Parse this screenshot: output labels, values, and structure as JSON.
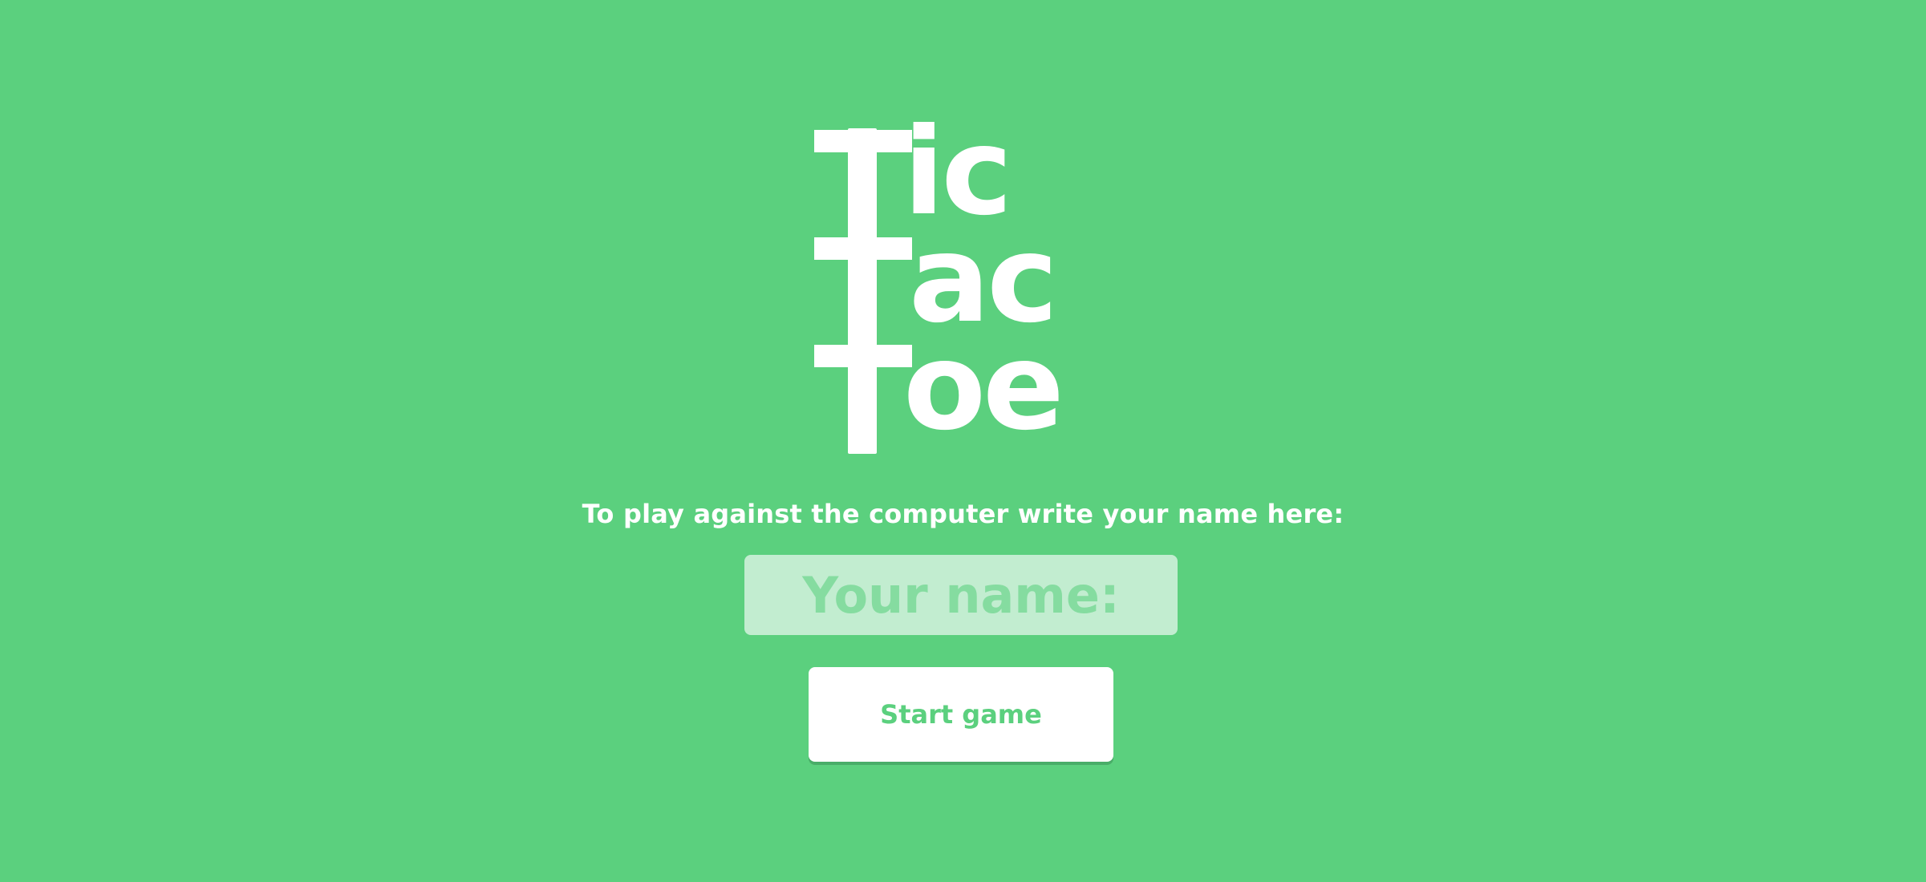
{
  "logo": {
    "line1": "Tic",
    "line2": "Tac",
    "line3": "Toe",
    "line1_visible": "ic",
    "line2_visible": "ac",
    "line3_visible": "oe"
  },
  "prompt": {
    "text": "To play against the computer write your name here:"
  },
  "name_input": {
    "value": "",
    "placeholder": "Your name:"
  },
  "start_button": {
    "label": "Start game"
  },
  "colors": {
    "background": "#5bd07e",
    "text": "#ffffff",
    "input_background": "#c2edd0",
    "input_placeholder": "#85dca0",
    "button_text": "#5bd07e"
  }
}
